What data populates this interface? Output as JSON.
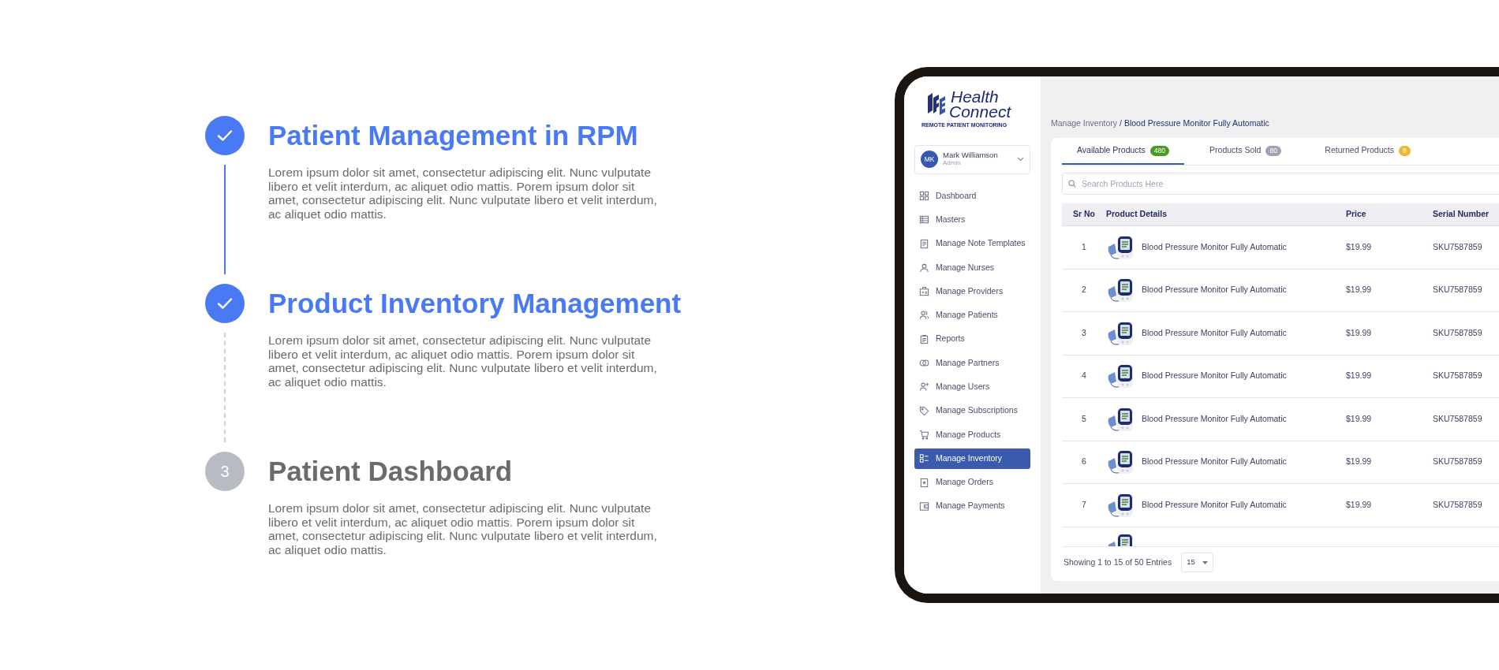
{
  "steps": [
    {
      "title": "Patient Management in RPM",
      "description": "Lorem ipsum dolor sit amet, consectetur adipiscing elit. Nunc vulputate libero et velit interdum, ac aliquet odio mattis. Porem ipsum dolor sit amet, consectetur adipiscing elit. Nunc vulputate libero et velit interdum, ac aliquet odio mattis.",
      "completed": true
    },
    {
      "title": "Product Inventory Management",
      "description": "Lorem ipsum dolor sit amet, consectetur adipiscing elit. Nunc vulputate libero et velit interdum, ac aliquet odio mattis. Porem ipsum dolor sit amet, consectetur adipiscing elit. Nunc vulputate libero et velit interdum, ac aliquet odio mattis.",
      "completed": true
    },
    {
      "title": "Patient Dashboard",
      "description": "Lorem ipsum dolor sit amet, consectetur adipiscing elit. Nunc vulputate libero et velit interdum, ac aliquet odio mattis. Porem ipsum dolor sit amet, consectetur adipiscing elit. Nunc vulputate libero et velit interdum, ac aliquet odio mattis.",
      "completed": false,
      "number": "3"
    }
  ],
  "app": {
    "logo": {
      "line1": "Health",
      "line2": "Connect",
      "tagline": "REMOTE PATIENT MONITORING"
    },
    "user": {
      "initials": "MK",
      "name": "Mark Williamson",
      "role": "Admin"
    },
    "sidebar": {
      "items": [
        {
          "label": "Dashboard",
          "selected": false
        },
        {
          "label": "Masters",
          "selected": false
        },
        {
          "label": "Manage Note Templates",
          "selected": false
        },
        {
          "label": "Manage Nurses",
          "selected": false
        },
        {
          "label": "Manage Providers",
          "selected": false
        },
        {
          "label": "Manage Patients",
          "selected": false
        },
        {
          "label": "Reports",
          "selected": false
        },
        {
          "label": "Manage Partners",
          "selected": false
        },
        {
          "label": "Manage Users",
          "selected": false
        },
        {
          "label": "Manage Subscriptions",
          "selected": false
        },
        {
          "label": "Manage Products",
          "selected": false
        },
        {
          "label": "Manage Inventory",
          "selected": true
        },
        {
          "label": "Manage Orders",
          "selected": false
        },
        {
          "label": "Manage Payments",
          "selected": false
        }
      ]
    },
    "breadcrumb": {
      "parent": "Manage Inventory",
      "current": "/ Blood Pressure Monitor Fully Automatic"
    },
    "tabs": [
      {
        "label": "Available Products",
        "count": "480",
        "color": "#4e9a22",
        "selected": true
      },
      {
        "label": "Products Sold",
        "count": "80",
        "color": "#a0a3b1",
        "selected": false
      },
      {
        "label": "Returned Products",
        "count": "8",
        "color": "#e9b82e",
        "selected": false
      }
    ],
    "search": {
      "placeholder": "Search Products Here"
    },
    "table": {
      "columns": [
        "Sr No",
        "Product Details",
        "Price",
        "Serial Number"
      ],
      "rows": [
        {
          "sr": "1",
          "product": "Blood Pressure Monitor Fully Automatic",
          "price": "$19.99",
          "serial": "SKU7587859"
        },
        {
          "sr": "2",
          "product": "Blood Pressure Monitor Fully Automatic",
          "price": "$19.99",
          "serial": "SKU7587859"
        },
        {
          "sr": "3",
          "product": "Blood Pressure Monitor Fully Automatic",
          "price": "$19.99",
          "serial": "SKU7587859"
        },
        {
          "sr": "4",
          "product": "Blood Pressure Monitor Fully Automatic",
          "price": "$19.99",
          "serial": "SKU7587859"
        },
        {
          "sr": "5",
          "product": "Blood Pressure Monitor Fully Automatic",
          "price": "$19.99",
          "serial": "SKU7587859"
        },
        {
          "sr": "6",
          "product": "Blood Pressure Monitor Fully Automatic",
          "price": "$19.99",
          "serial": "SKU7587859"
        },
        {
          "sr": "7",
          "product": "Blood Pressure Monitor Fully Automatic",
          "price": "$19.99",
          "serial": "SKU7587859"
        }
      ]
    },
    "footer": {
      "summary": "Showing 1 to 15 of 50 Entries",
      "page_size": "15"
    }
  }
}
